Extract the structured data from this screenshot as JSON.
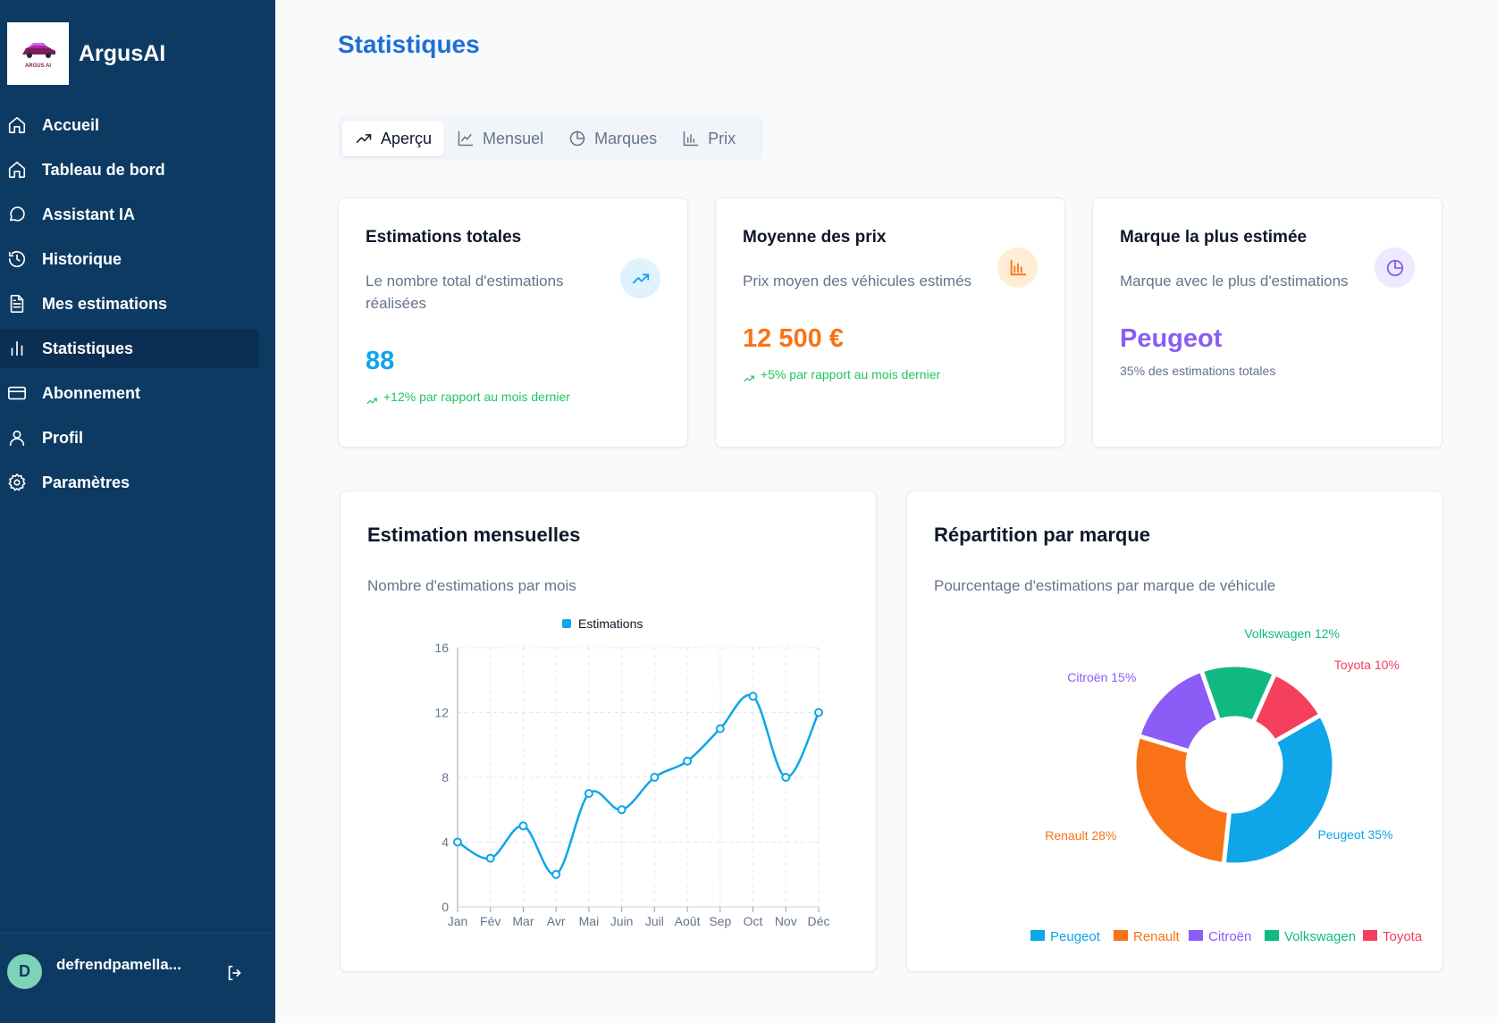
{
  "app": {
    "name": "ArgusAI",
    "logo_text": "ARGUS AI"
  },
  "sidebar": {
    "items": [
      {
        "label": "Accueil",
        "icon": "home-icon"
      },
      {
        "label": "Tableau de bord",
        "icon": "home-icon"
      },
      {
        "label": "Assistant IA",
        "icon": "chat-bubble-icon"
      },
      {
        "label": "Historique",
        "icon": "history-icon"
      },
      {
        "label": "Mes estimations",
        "icon": "document-icon"
      },
      {
        "label": "Statistiques",
        "icon": "bar-chart-icon",
        "active": true
      },
      {
        "label": "Abonnement",
        "icon": "credit-card-icon"
      },
      {
        "label": "Profil",
        "icon": "user-icon"
      },
      {
        "label": "Paramètres",
        "icon": "gear-icon"
      }
    ],
    "user": {
      "initial": "D",
      "name": "defrendpamella..."
    }
  },
  "page": {
    "title": "Statistiques",
    "tabs": [
      {
        "label": "Aperçu",
        "icon": "trending-up-icon",
        "active": true
      },
      {
        "label": "Mensuel",
        "icon": "line-chart-icon"
      },
      {
        "label": "Marques",
        "icon": "pie-chart-icon"
      },
      {
        "label": "Prix",
        "icon": "bar-chart-icon"
      }
    ]
  },
  "stats": {
    "total": {
      "title": "Estimations totales",
      "desc_line1": "Le nombre total d'estimations",
      "desc_line2": "réalisées",
      "value": "88",
      "sub": "+12% par rapport au mois dernier",
      "color": "#0ea5e9"
    },
    "avg_price": {
      "title": "Moyenne des prix",
      "desc": "Prix moyen des véhicules estimés",
      "value": "12 500 €",
      "sub": "+5% par rapport au mois dernier",
      "color": "#f97316"
    },
    "top_brand": {
      "title": "Marque la plus estimée",
      "desc": "Marque avec le plus d'estimations",
      "value": "Peugeot",
      "sub": "35% des estimations totales",
      "color": "#8b5cf6"
    }
  },
  "monthly_card": {
    "title": "Estimation mensuelles",
    "desc": "Nombre d'estimations par mois"
  },
  "brand_card": {
    "title": "Répartition par marque",
    "desc": "Pourcentage d'estimations par marque de véhicule"
  },
  "chart_data": [
    {
      "type": "line",
      "categories": [
        "Jan",
        "Fév",
        "Mar",
        "Avr",
        "Mai",
        "Juin",
        "Juil",
        "Août",
        "Sep",
        "Oct",
        "Nov",
        "Déc"
      ],
      "series": [
        {
          "name": "Estimations",
          "values": [
            4,
            3,
            5,
            2,
            7,
            6,
            8,
            9,
            11,
            13,
            8,
            12
          ],
          "color": "#0ea5e9"
        }
      ],
      "y_ticks": [
        0,
        4,
        8,
        12,
        16
      ],
      "ylim": [
        0,
        16
      ],
      "grid": true,
      "legend": "top"
    },
    {
      "type": "pie",
      "labels": [
        "Peugeot",
        "Renault",
        "Citroën",
        "Volkswagen",
        "Toyota"
      ],
      "values": [
        35,
        28,
        15,
        12,
        10
      ],
      "slice_labels": [
        "Peugeot 35%",
        "Renault 28%",
        "Citroën 15%",
        "Volkswagen 12%",
        "Toyota 10%"
      ],
      "colors": [
        "#0ea5e9",
        "#f97316",
        "#8b5cf6",
        "#10b981",
        "#f43f5e"
      ],
      "donut": true,
      "legend": "bottom"
    }
  ]
}
